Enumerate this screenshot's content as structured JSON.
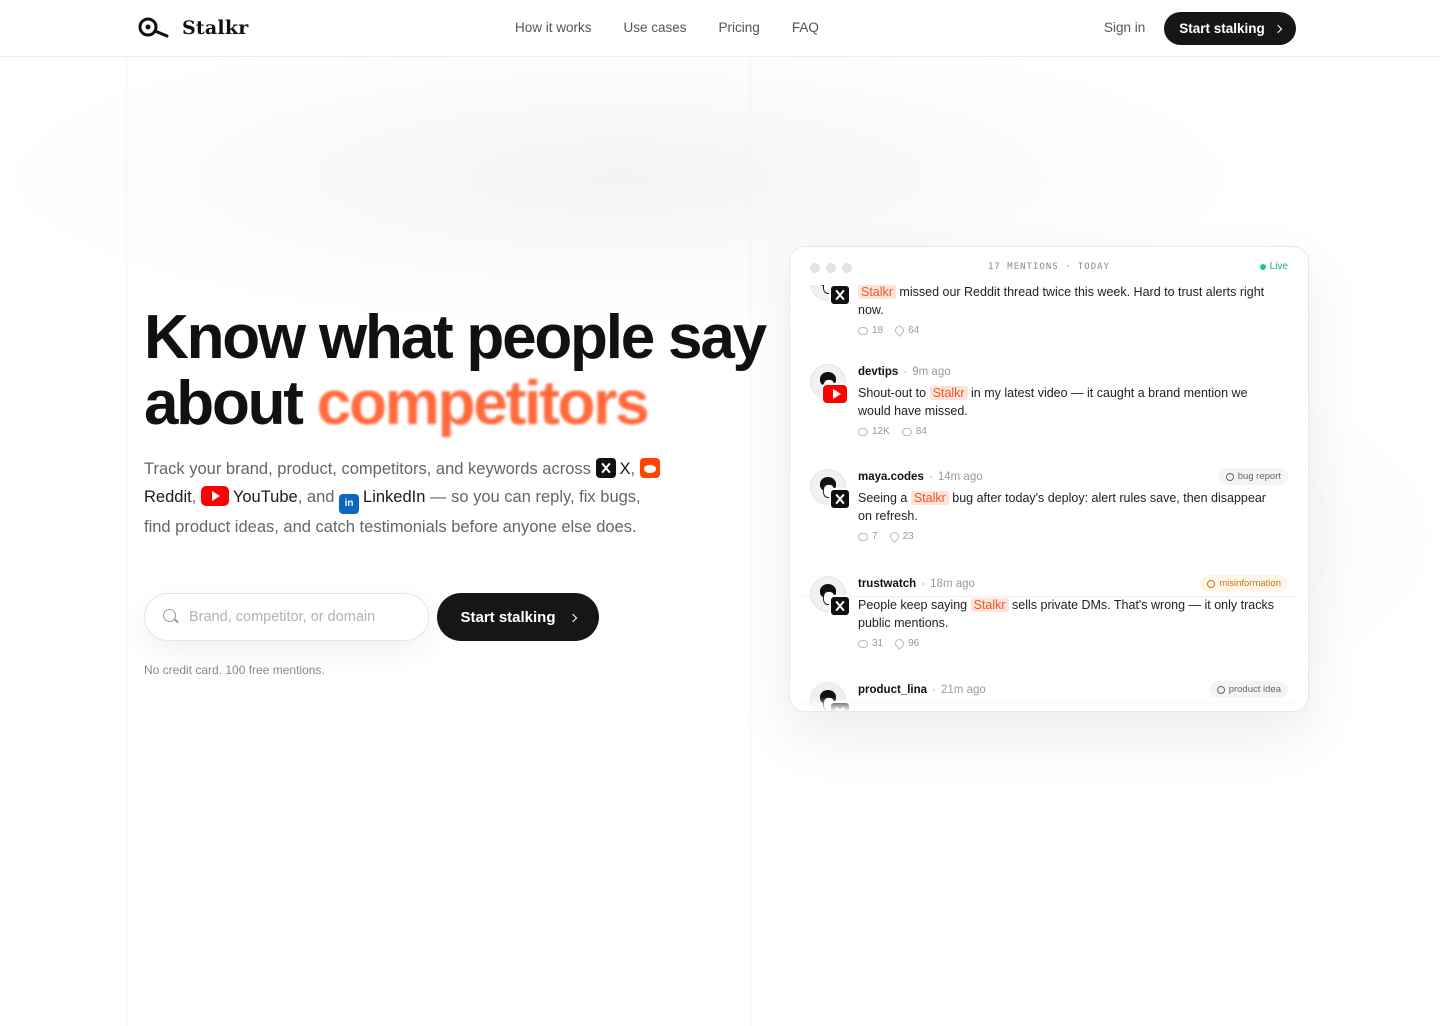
{
  "nav": {
    "brand": "Stalkr",
    "links": [
      "How it works",
      "Use cases",
      "Pricing",
      "FAQ"
    ],
    "sign_in": "Sign in",
    "cta": "Start stalking"
  },
  "hero": {
    "headline_line1": "Know what people say",
    "headline_about": "about",
    "headline_accent": "competitors",
    "sub_prefix": "Track your brand, product, competitors, and keywords across",
    "platforms": [
      "X",
      "Reddit",
      "YouTube",
      "LinkedIn"
    ],
    "sub_and": "and",
    "sub_suffix": "— so you can reply, fix bugs, find product ideas, and catch testimonials before anyone else does.",
    "search_placeholder": "Brand, competitor, or domain",
    "cta": "Start stalking",
    "fine_print": "No credit card. 100 free mentions.",
    "accent_color": "#ff6a3d"
  },
  "feed": {
    "header": "17 MENTIONS · TODAY",
    "live": "Live",
    "posts": [
      {
        "platform": "x",
        "user": "",
        "time": "",
        "text_pre": "",
        "highlight": "Stalkr",
        "text_post": " missed our Reddit thread twice this week. Hard to trust alerts right now.",
        "stat1": "18",
        "stat2": "64",
        "tag": ""
      },
      {
        "platform": "youtube",
        "user": "devtips",
        "time": "9m ago",
        "text_pre": "Shout-out to ",
        "highlight": "Stalkr",
        "text_post": " in my latest video — it caught a brand mention we would have missed.",
        "stat1": "12K",
        "stat2": "84",
        "tag": ""
      },
      {
        "platform": "x",
        "user": "maya.codes",
        "time": "14m ago",
        "text_pre": "Seeing a ",
        "highlight": "Stalkr",
        "text_post": " bug after today's deploy: alert rules save, then disappear on refresh.",
        "stat1": "7",
        "stat2": "23",
        "tag": "bug report"
      },
      {
        "platform": "x",
        "user": "trustwatch",
        "time": "18m ago",
        "text_pre": "People keep saying ",
        "highlight": "Stalkr",
        "text_post": " sells private DMs. That's wrong — it only tracks public mentions.",
        "stat1": "31",
        "stat2": "96",
        "tag": "misinformation"
      },
      {
        "platform": "x",
        "user": "product_lina",
        "time": "21m ago",
        "text_pre": "",
        "highlight": "",
        "text_post": "",
        "stat1": "",
        "stat2": "",
        "tag": "product idea"
      }
    ]
  }
}
